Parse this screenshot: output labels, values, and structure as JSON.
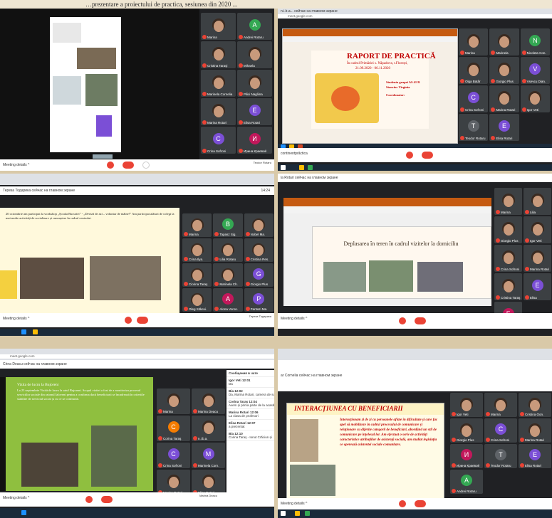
{
  "caption": "…prezentare a proiectului de practica, sesiunea din 2020 ... ",
  "panels": [
    {
      "tiles": [
        {
          "name": "Marina",
          "color": "#c89a7c"
        },
        {
          "name": "Andrei Rotaru",
          "avatar": "A",
          "color": "#34a853"
        },
        {
          "name": "Cristina Taraşi",
          "color": "#c89a7c"
        },
        {
          "name": "Mihaela",
          "color": "#c89a7c"
        },
        {
          "name": "Marinela Cornelia",
          "color": "#c89a7c"
        },
        {
          "name": "Pilici Nagliina",
          "color": "#c89a7c"
        },
        {
          "name": "Marina Rotari",
          "color": "#c89a7c"
        },
        {
          "name": "Elisa Rotari",
          "avatar": "E",
          "color": "#7b4fd6"
        },
        {
          "name": "Crina Sofroni",
          "avatar": "C",
          "color": "#7b4fd6"
        },
        {
          "name": "Ирина Краевой",
          "avatar": "И",
          "color": "#c2185b"
        }
      ],
      "footer_left": "Meeting details ^",
      "footer_right": "Teodor Rotaru"
    },
    {
      "url": "meet.google.com",
      "meet_title": "n.i.b.a... сейчас на главном экране",
      "slide_title": "RAPORT DE PRACTICĂ",
      "slide_sub1": "În cadrul Primăriei s. Năpadova, r.Florești,",
      "slide_sub2": "21.09.2020 - 06.11.2020",
      "slide_author": "Studenta grupei AS 41 R",
      "slide_author2": "Stanciuc Virginia",
      "slide_coord": "Coordonator:",
      "tiles": [
        {
          "name": "Marina",
          "color": "#c89a7c"
        },
        {
          "name": "Marinela",
          "color": "#c89a7c"
        },
        {
          "name": "Nicoleta Con.",
          "avatar": "N",
          "color": "#34a853"
        },
        {
          "name": "Olga Batâr",
          "color": "#c89a7c"
        },
        {
          "name": "Giorgio Plus",
          "color": "#c89a7c"
        },
        {
          "name": "Vsevcu Dian.",
          "avatar": "V",
          "color": "#7b4fd6"
        },
        {
          "name": "Crina Sofroni",
          "avatar": "C",
          "color": "#7b4fd6"
        },
        {
          "name": "Marina Rotari",
          "color": "#c89a7c"
        },
        {
          "name": "Igor Veti",
          "color": "#c89a7c"
        },
        {
          "name": "Teodor Rotaru",
          "avatar": "T",
          "color": "#5f6368"
        },
        {
          "name": "Elisa Rotari",
          "avatar": "E",
          "color": "#7b4fd6"
        }
      ],
      "footer_left": "continentprăctica"
    },
    {
      "meet_title": "Тереза Тодарика сейчас на главном экране",
      "time": "14:24",
      "slide_text": "20 octombrie am participat la workshop „Școala Bucuriei” - „Deviză de azi – voluntar de mâine!” Am participat alături de colegi la mai multe activități de socializare și cunoaștere în cadrul centrului.",
      "tiles": [
        {
          "name": "Marina",
          "color": "#c89a7c"
        },
        {
          "name": "Tapasz Sig.",
          "avatar": "B",
          "color": "#34a853"
        },
        {
          "name": "Nobel Ma.",
          "color": "#c89a7c"
        },
        {
          "name": "Crina Ilya.",
          "color": "#c89a7c"
        },
        {
          "name": "Lilia Rotaru",
          "color": "#c89a7c"
        },
        {
          "name": "Cristina Res.",
          "color": "#c89a7c"
        },
        {
          "name": "Ciorina Taraş",
          "color": "#c89a7c"
        },
        {
          "name": "Marinela Ch.",
          "color": "#c89a7c"
        },
        {
          "name": "Giorgio Plus",
          "avatar": "G",
          "color": "#7b4fd6"
        },
        {
          "name": "Oleg Sitkevi.",
          "color": "#c89a7c"
        },
        {
          "name": "Alona Voron.",
          "avatar": "A",
          "color": "#c2185b"
        },
        {
          "name": "Pantazi Ma.",
          "avatar": "P",
          "color": "#7b4fd6"
        }
      ],
      "footer_left": "Meeting details ^",
      "footer_right": "Тереза Тодарика"
    },
    {
      "meet_title": "la Rotari сейчас на главном экране",
      "slide_title": "Deplasarea în teren în cadrul vizitelor la domiciliu",
      "tiles": [
        {
          "name": "Marina",
          "color": "#c89a7c"
        },
        {
          "name": "Lilia",
          "color": "#c89a7c"
        },
        {
          "name": "Giorgio Plus",
          "color": "#c89a7c"
        },
        {
          "name": "Igor Veti",
          "color": "#c89a7c"
        },
        {
          "name": "Crina Sofroni",
          "color": "#c89a7c"
        },
        {
          "name": "Marina Rotari",
          "color": "#c89a7c"
        },
        {
          "name": "Cristina Taraş",
          "color": "#c89a7c"
        },
        {
          "name": "Elisa",
          "avatar": "E",
          "color": "#7b4fd6"
        },
        {
          "name": "Francis Pânzar",
          "avatar": "F",
          "color": "#c2185b"
        }
      ],
      "footer_left": "Meeting details ^"
    },
    {
      "url": "meet.google.com",
      "meet_title": "Crina Deacu сейчас на главном экране",
      "slide_text1": "Vizita de lucru la Bujoreni",
      "slide_text2": "La 23 septembrie Vizită de lucru la satul Bujoreni. Scopul vizitei a fost de a monitoriza procesul serviciilor sociale din raionul Ialoveni pentru a confirma dacă beneficiarii se încadrează în criteriile stabilite de serviciul social și cu ce se confruntă.",
      "chat_header": "Сообщения в чате",
      "chat": [
        {
          "name": "Igor Veti",
          "msg": "Da",
          "time": "12:01"
        },
        {
          "name": "Bia",
          "msg": "Da, Marina Rotari, camera de sus",
          "time": "12:02"
        },
        {
          "name": "Corina Taraş",
          "msg": "Avem și prima parte de la acasă",
          "time": "12:04"
        },
        {
          "name": "Marina Rotari",
          "msg": "La clasa de profesori",
          "time": "12:06"
        },
        {
          "name": "Elisa Rotari",
          "msg": "a prezentat",
          "time": "12:07"
        },
        {
          "name": "Bia",
          "msg": "Corina Taraş - Ionut Crăciun și",
          "time": "12:10"
        }
      ],
      "tiles": [
        {
          "name": "Marina",
          "color": "#c89a7c"
        },
        {
          "name": "Marina Deacu",
          "color": "#c89a7c"
        },
        {
          "name": "Corina Taraş",
          "avatar": "C",
          "color": "#f57c00"
        },
        {
          "name": "n.i.b.a.",
          "color": "#c89a7c"
        },
        {
          "name": "Crina Sofroni",
          "avatar": "C",
          "color": "#7b4fd6"
        },
        {
          "name": "Marinela Corn.",
          "avatar": "M",
          "color": "#7b4fd6"
        },
        {
          "name": "Marina Rotari",
          "color": "#c89a7c"
        },
        {
          "name": "Elisa Rotari",
          "color": "#c89a7c"
        }
      ],
      "footer_left": "Meeting details ^",
      "footer_right": "Marina Deacu"
    },
    {
      "meet_title": "ar Cornelia сейчас на главном экране",
      "slide_title": "INTERACȚIUNEA CU BENEFICIARII",
      "slide_text": "Interacționam zi de zi cu persoanele aflate în dificultate și care fac apel să mobilizeze în cadrul procesului de comunicare și relaționare cu diferite categorii de beneficiari, abordând un stil de comunicare pe înțelesul lor. Am efectuat o serie de activități caracteristice atribuțiilor de asistență socială, am studiat legislația ce operează asistentei sociale comunitare.",
      "tiles": [
        {
          "name": "Igor Veti",
          "color": "#c89a7c"
        },
        {
          "name": "Marina",
          "color": "#c89a7c"
        },
        {
          "name": "Cristina Oon.",
          "color": "#c89a7c"
        },
        {
          "name": "Giorgio Plus",
          "color": "#c89a7c"
        },
        {
          "name": "Crina Sofroni",
          "avatar": "C",
          "color": "#7b4fd6"
        },
        {
          "name": "Marina Rotari",
          "color": "#c89a7c"
        },
        {
          "name": "Ирина Краевой",
          "avatar": "И",
          "color": "#c2185b"
        },
        {
          "name": "Teodor Rotaru",
          "avatar": "T",
          "color": "#5f6368"
        },
        {
          "name": "Elisa Rotari",
          "avatar": "E",
          "color": "#7b4fd6"
        },
        {
          "name": "Andrei Rotaru",
          "avatar": "A",
          "color": "#34a853"
        }
      ],
      "footer_left": "Meeting details ^"
    }
  ]
}
